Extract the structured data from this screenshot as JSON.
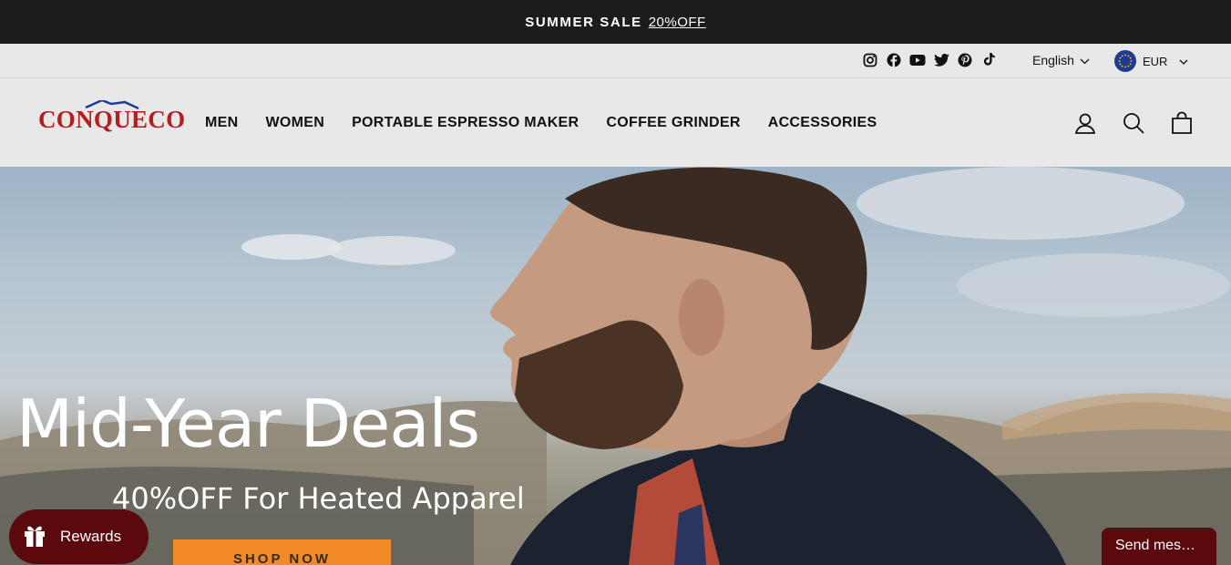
{
  "announcement": {
    "text": "SUMMER SALE",
    "link": "20%OFF"
  },
  "utility": {
    "socials": [
      "instagram-icon",
      "facebook-icon",
      "youtube-icon",
      "twitter-icon",
      "pinterest-icon",
      "tiktok-icon"
    ],
    "language": "English",
    "currency": "EUR"
  },
  "header": {
    "logo": "CONQUECO",
    "nav": [
      "MEN",
      "WOMEN",
      "PORTABLE ESPRESSO MAKER",
      "COFFEE GRINDER",
      "ACCESSORIES"
    ],
    "icons": [
      "account-icon",
      "search-icon",
      "cart-icon"
    ]
  },
  "hero": {
    "title": "Mid-Year Deals",
    "subtitle": "40%OFF For Heated Apparel",
    "button": "SHOP NOW"
  },
  "widgets": {
    "rewards": "Rewards",
    "chat": "Send mes…"
  },
  "colors": {
    "announcement_bg": "#1c1c1c",
    "header_bg": "#e8e8e8",
    "logo": "#b41e1e",
    "cta": "#f28a28",
    "widget": "#5a0a0d"
  }
}
